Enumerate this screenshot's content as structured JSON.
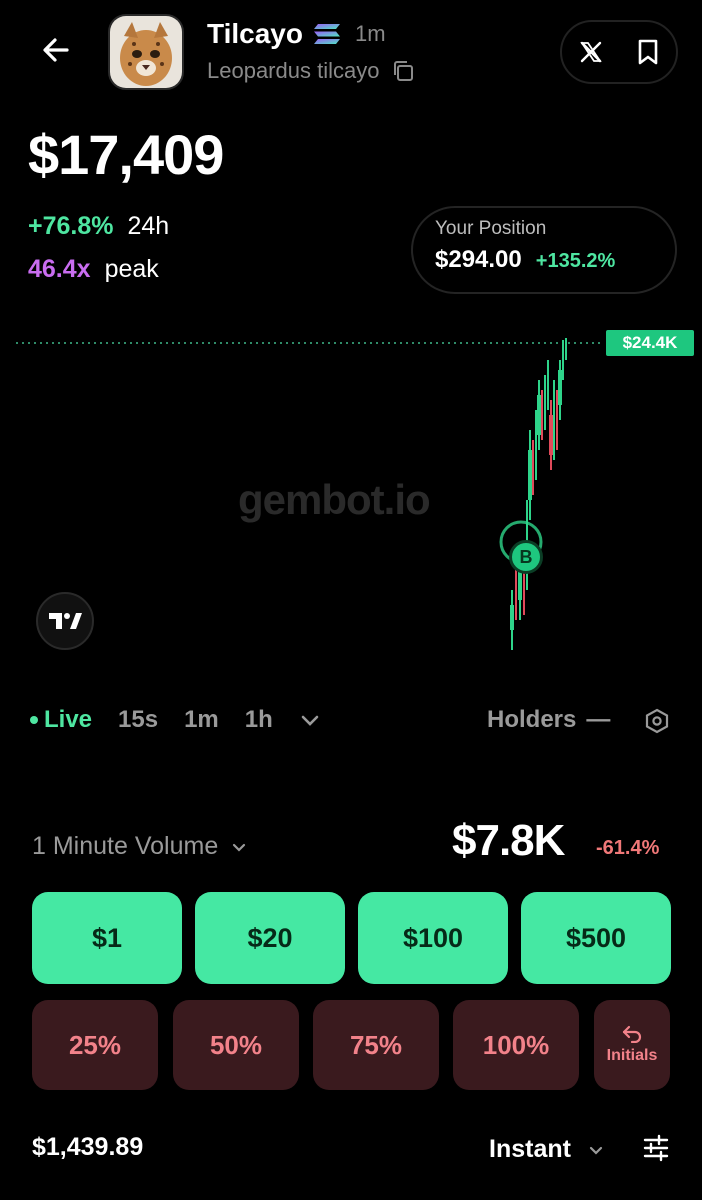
{
  "header": {
    "back_icon": "arrow-left-icon",
    "token_name": "Tilcayo",
    "chain_icon": "solana-icon",
    "age": "1m",
    "token_full_name": "Leopardus tilcayo",
    "copy_icon": "copy-icon",
    "x_icon": "x-logo-icon",
    "bookmark_icon": "bookmark-icon"
  },
  "price": {
    "value": "$17,409",
    "change_24h": "+76.8%",
    "change_period": "24h",
    "peak_multiple": "46.4x",
    "peak_label": "peak"
  },
  "position": {
    "label": "Your Position",
    "amount": "$294.00",
    "pnl": "+135.2%"
  },
  "chart": {
    "price_tag": "$24.4K",
    "watermark": "gembot.io",
    "tv_logo": "TV",
    "buy_marker": "B"
  },
  "timeframes": {
    "live": "Live",
    "items": [
      "15s",
      "1m",
      "1h"
    ],
    "more_icon": "chevron-down-icon",
    "holders": "Holders",
    "holders_value": "—",
    "settings_icon": "hexagon-settings-icon"
  },
  "volume": {
    "label": "1 Minute Volume",
    "value": "$7.8K",
    "change": "-61.4%"
  },
  "buy_amounts": [
    "$1",
    "$20",
    "$100",
    "$500"
  ],
  "sell_percents": [
    "25%",
    "50%",
    "75%",
    "100%"
  ],
  "initials": {
    "label": "Initials",
    "icon": "undo-icon"
  },
  "footer": {
    "balance": "$1,439.89",
    "mode": "Instant",
    "filter_icon": "sliders-icon"
  },
  "colors": {
    "accent_green": "#45e8a3",
    "positive": "#4ee6a1",
    "negative": "#f07878",
    "peak_purple": "#c96df0",
    "sell_bg": "#3a1a1e"
  }
}
